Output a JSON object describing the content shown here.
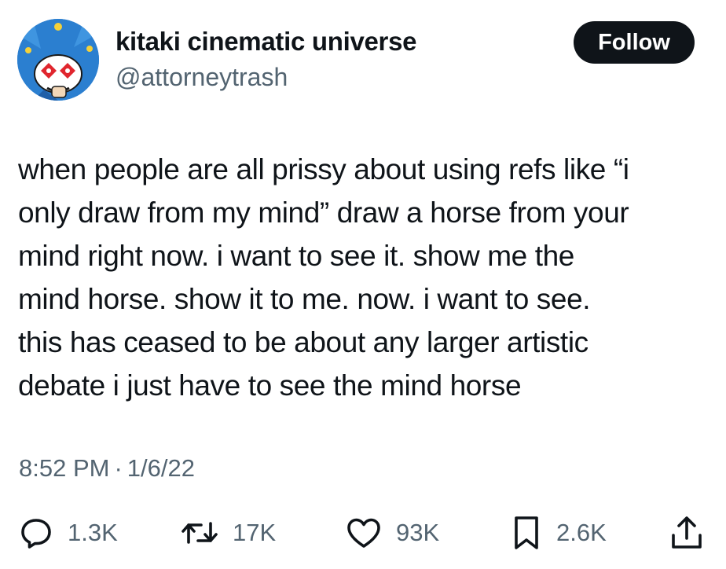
{
  "user": {
    "display_name": "kitaki cinematic universe",
    "handle": "@attorneytrash",
    "follow_label": "Follow"
  },
  "tweet": {
    "lines": [
      "when people are all prissy about using refs like “i",
      "only draw from my mind” draw a horse from your",
      "mind right now. i want to see it. show me the",
      "mind horse. show it to me. now. i want to see.",
      "this has ceased to be about any larger artistic",
      "debate i just have to see the mind horse"
    ],
    "time": "8:52 PM",
    "separator": "·",
    "date": "1/6/22"
  },
  "actions": {
    "replies": {
      "icon": "reply-icon",
      "count": "1.3K"
    },
    "retweets": {
      "icon": "retweet-icon",
      "count": "17K"
    },
    "likes": {
      "icon": "heart-icon",
      "count": "93K"
    },
    "bookmarks": {
      "icon": "bookmark-icon",
      "count": "2.6K"
    },
    "share": {
      "icon": "share-icon"
    }
  },
  "colors": {
    "text": "#0f1419",
    "secondary": "#536471",
    "button_bg": "#0f1419",
    "button_text": "#ffffff",
    "avatar_bg": "#2b7fd0"
  }
}
